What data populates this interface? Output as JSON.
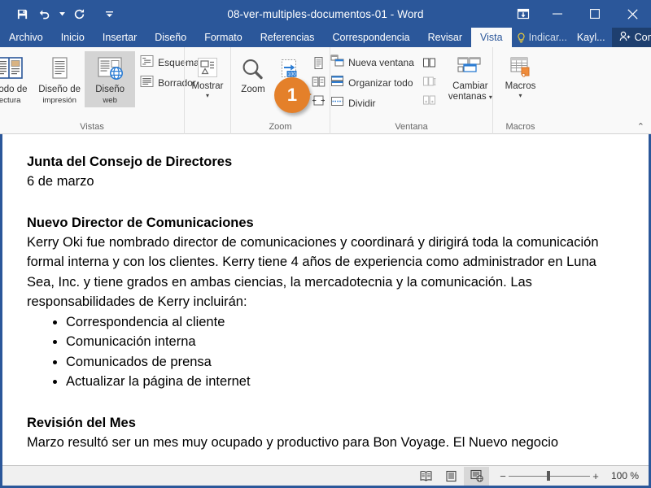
{
  "titlebar": {
    "document_title": "08-ver-multiples-documentos-01  -  Word",
    "qat": [
      {
        "name": "save-icon",
        "label": "Guardar"
      },
      {
        "name": "undo-icon",
        "label": "Deshacer"
      },
      {
        "name": "redo-icon",
        "label": "Rehacer"
      },
      {
        "name": "customize-quick-access-toolbar-icon",
        "label": "Personalizar barra de herramientas de acceso rápido"
      }
    ],
    "window_controls": [
      {
        "name": "ribbon-display-options-icon",
        "label": "Opciones de presentación de la cinta"
      },
      {
        "name": "minimize-icon",
        "label": "Minimizar"
      },
      {
        "name": "maximize-icon",
        "label": "Maximizar"
      },
      {
        "name": "close-icon",
        "label": "Cerrar"
      }
    ]
  },
  "tabs": [
    {
      "label": "Archivo",
      "active": false
    },
    {
      "label": "Inicio",
      "active": false
    },
    {
      "label": "Insertar",
      "active": false
    },
    {
      "label": "Diseño",
      "active": false
    },
    {
      "label": "Formato",
      "active": false
    },
    {
      "label": "Referencias",
      "active": false
    },
    {
      "label": "Correspondencia",
      "active": false
    },
    {
      "label": "Revisar",
      "active": false
    },
    {
      "label": "Vista",
      "active": true
    }
  ],
  "tell_me": "Indicar...",
  "account": "Kayl...",
  "share_label": "Compartir",
  "ribbon": {
    "groups": [
      {
        "label": "Vistas",
        "big_buttons": [
          {
            "line1": "Modo de",
            "line2": "lectura",
            "selected": false,
            "icon": "read-mode-icon"
          },
          {
            "line1": "Diseño de",
            "line2": "impresión",
            "selected": false,
            "icon": "print-layout-icon"
          },
          {
            "line1": "Diseño",
            "line2": "web",
            "selected": true,
            "icon": "web-layout-icon"
          }
        ],
        "small_buttons": [
          {
            "label": "Esquema",
            "icon": "outline-icon"
          },
          {
            "label": "Borrador",
            "icon": "draft-icon"
          }
        ]
      },
      {
        "label": "",
        "menu_button": {
          "label": "Mostrar",
          "icon": "show-icon",
          "caret": "▾"
        }
      },
      {
        "label": "Zoom",
        "big_buttons": [
          {
            "line1": "Zoom",
            "line2": "",
            "selected": false,
            "icon": "zoom-icon"
          },
          {
            "line1": "100%",
            "line2": "",
            "selected": false,
            "icon": "zoom-100-icon"
          }
        ],
        "icon_column": [
          {
            "name": "one-page-icon",
            "label": "Una página"
          },
          {
            "name": "multiple-pages-icon",
            "label": "Varias páginas"
          },
          {
            "name": "page-width-icon",
            "label": "Ancho de página"
          }
        ]
      },
      {
        "label": "Ventana",
        "small_buttons": [
          {
            "label": "Nueva ventana",
            "icon": "new-window-icon"
          },
          {
            "label": "Organizar todo",
            "icon": "arrange-all-icon"
          },
          {
            "label": "Dividir",
            "icon": "split-icon"
          }
        ],
        "icon_column": [
          {
            "name": "view-side-by-side-icon",
            "label": "Ver en paralelo"
          },
          {
            "name": "synchronous-scrolling-icon",
            "label": "Desplazamiento sincrónico"
          },
          {
            "name": "reset-window-position-icon",
            "label": "Restablecer posición de la ventana"
          }
        ],
        "menu_button": {
          "label_line1": "Cambiar",
          "label_line2": "ventanas",
          "icon": "switch-windows-icon",
          "caret": "▾"
        }
      },
      {
        "label": "Macros",
        "menu_button": {
          "label": "Macros",
          "icon": "macros-icon",
          "caret": "▾"
        }
      }
    ],
    "collapse_label": "⌃"
  },
  "callout": {
    "number": "1",
    "color": "#e4802a"
  },
  "document": {
    "heading1": "Junta del Consejo de Directores",
    "date": "6 de marzo",
    "heading2": "Nuevo Director de Comunicaciones",
    "paragraph1": "Kerry Oki fue nombrado director de comunicaciones y coordinará y dirigirá toda la comunicación formal interna y con los clientes. Kerry tiene 4 años de experiencia como administrador en Luna Sea, Inc. y tiene grados en ambas ciencias, la mercadotecnia y la comunicación. Las responsabilidades de Kerry incluirán:",
    "bullets": [
      "Correspondencia al cliente",
      "Comunicación interna",
      "Comunicados de prensa",
      "Actualizar la página de internet"
    ],
    "heading3": "Revisión del Mes",
    "paragraph2": "Marzo resultó ser un mes muy ocupado y productivo para Bon Voyage. El Nuevo negocio"
  },
  "statusbar": {
    "views": [
      {
        "name": "read-mode-view-icon",
        "label": "Modo de lectura",
        "active": false
      },
      {
        "name": "print-layout-view-icon",
        "label": "Diseño de impresión",
        "active": false
      },
      {
        "name": "web-layout-view-icon",
        "label": "Diseño web",
        "active": true
      }
    ],
    "zoom_out": "−",
    "zoom_in": "+",
    "zoom_percent": "100 %"
  },
  "colors": {
    "word_blue": "#2b579a",
    "share_blue": "#1e3f6f",
    "ribbon_bg": "#f9f9f9",
    "accent_orange": "#e4802a"
  }
}
